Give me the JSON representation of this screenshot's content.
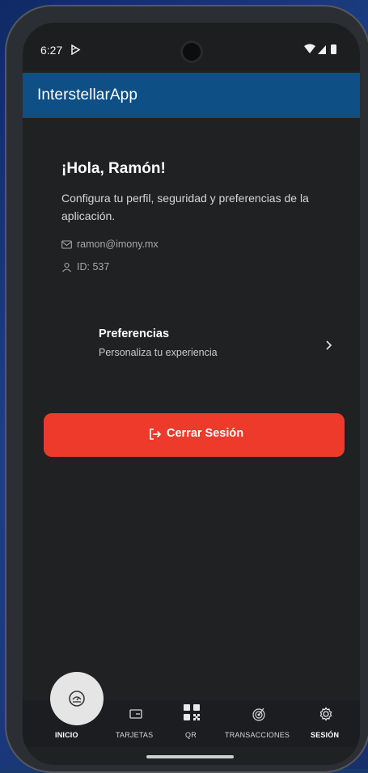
{
  "status_bar": {
    "time": "6:27"
  },
  "app_bar": {
    "title": "InterstellarApp"
  },
  "profile": {
    "greeting": "¡Hola, Ramón!",
    "subtitle": "Configura tu perfil, seguridad y preferencias de la aplicación.",
    "email": "ramon@imony.mx",
    "user_id": "ID: 537"
  },
  "preferences": {
    "title": "Preferencias",
    "subtitle": "Personaliza tu experiencia"
  },
  "logout": {
    "label": "Cerrar Sesión",
    "color": "#ee3a2b"
  },
  "bottom_nav": {
    "items": [
      {
        "label": "INICIO",
        "icon": "gauge-icon",
        "active": false
      },
      {
        "label": "TARJETAS",
        "icon": "card-icon",
        "active": false
      },
      {
        "label": "QR",
        "icon": "qr-icon",
        "active": false
      },
      {
        "label": "TRANSACCIONES",
        "icon": "radar-icon",
        "active": false
      },
      {
        "label": "SESIÓN",
        "icon": "gear-icon",
        "active": true
      }
    ]
  },
  "colors": {
    "appbar": "#0e4f86",
    "background": "#202123",
    "accent": "#ee3a2b"
  }
}
